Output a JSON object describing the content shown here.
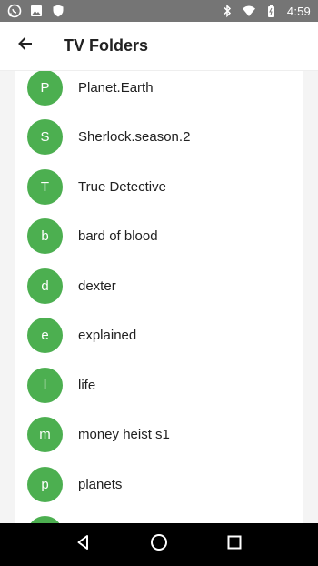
{
  "status_bar": {
    "time": "4:59",
    "icons_left": [
      "whatsapp-icon",
      "image-icon",
      "shield-icon"
    ],
    "icons_right": [
      "bluetooth-icon",
      "wifi-icon",
      "battery-icon"
    ]
  },
  "app_bar": {
    "title": "TV Folders",
    "back_icon": "arrow-back-icon"
  },
  "folders": [
    {
      "letter": "P",
      "name": "Planet.Earth"
    },
    {
      "letter": "S",
      "name": "Sherlock.season.2"
    },
    {
      "letter": "T",
      "name": "True Detective"
    },
    {
      "letter": "b",
      "name": "bard of blood"
    },
    {
      "letter": "d",
      "name": "dexter"
    },
    {
      "letter": "e",
      "name": "explained"
    },
    {
      "letter": "l",
      "name": "life"
    },
    {
      "letter": "m",
      "name": "money heist s1"
    },
    {
      "letter": "p",
      "name": "planets"
    }
  ],
  "colors": {
    "avatar": "#4caf50",
    "status_bar": "#757575",
    "nav_bar": "#000000"
  },
  "nav_bar": {
    "icons": [
      "back-triangle-icon",
      "home-circle-icon",
      "recents-square-icon"
    ]
  }
}
